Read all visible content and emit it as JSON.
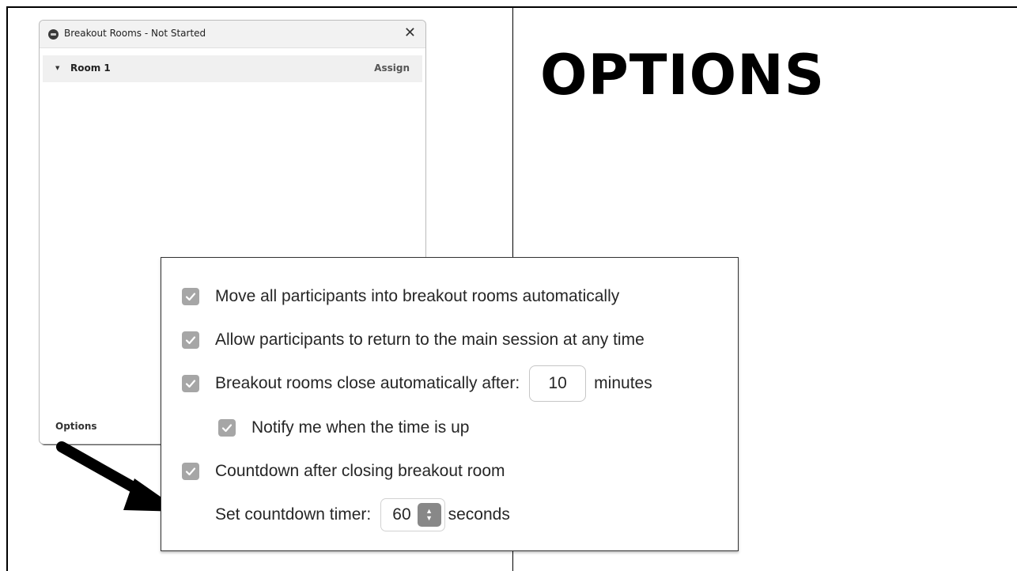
{
  "window": {
    "title": "Breakout Rooms - Not Started",
    "close_icon": "close-icon",
    "room": {
      "name": "Room 1",
      "assign_label": "Assign"
    },
    "options_label": "Options"
  },
  "heading": "OPTIONS",
  "options_panel": {
    "move_all": {
      "label": "Move all participants into breakout rooms automatically",
      "checked": true
    },
    "allow_return": {
      "label": "Allow participants to return to the main session at any time",
      "checked": true
    },
    "auto_close": {
      "label": "Breakout rooms close automatically after:",
      "value": "10",
      "unit": "minutes",
      "checked": true
    },
    "notify": {
      "label": "Notify me when the time is up",
      "checked": true
    },
    "countdown": {
      "label": "Countdown after closing breakout room",
      "checked": true
    },
    "countdown_timer": {
      "label": "Set countdown timer:",
      "value": "60",
      "unit": "seconds"
    }
  },
  "colors": {
    "checkbox": "#a6a6a6",
    "stepper": "#888888"
  }
}
